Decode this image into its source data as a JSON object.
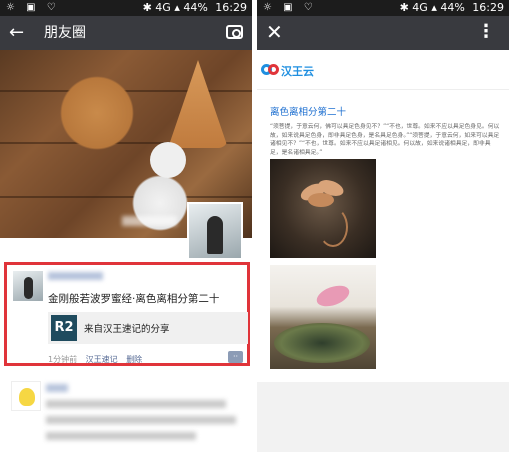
{
  "status_bar": {
    "battery": "44%",
    "time": "16:29",
    "network": "4G"
  },
  "left": {
    "appbar": {
      "title": "朋友圈",
      "back_icon": "arrow-left-icon",
      "camera_icon": "camera-icon"
    },
    "post": {
      "text": "金刚般若波罗蜜经·离色离相分第二十",
      "share_logo": "R2",
      "share_title": "来自汉王速记的分享",
      "time": "1分钟前",
      "source": "汉王速记",
      "delete": "删除"
    },
    "accent_color": "#e0343a",
    "link_color": "#576b95"
  },
  "right": {
    "appbar": {
      "close_icon": "close-icon",
      "more_icon": "more-vertical-icon"
    },
    "brand": "汉王云",
    "article": {
      "title": "离色离相分第二十",
      "body": "“须菩提，于意云何，佛可以具足色身见不？”“不也，世尊。如来不应以具足色身见。何以故，如来说具足色身，即非具足色身，是名具足色身。”“须菩提，于意云何，如来可以具足诸相见不？”“不也，世尊。如来不应以具足诸相见。何以故，如来说诸相具足，即非具足，是名诸相具足。”"
    }
  }
}
